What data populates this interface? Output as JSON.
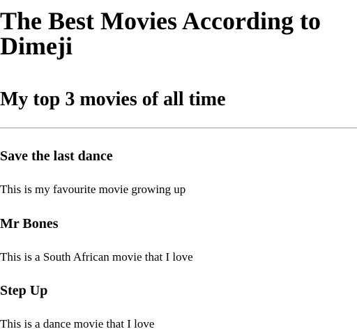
{
  "page": {
    "title": "The Best Movies According to Dimeji",
    "subtitle": "My top 3 movies of all time"
  },
  "movies": [
    {
      "title": "Save the last dance",
      "description": "This is my favourite movie growing up"
    },
    {
      "title": "Mr Bones",
      "description": "This is a South African movie that I love"
    },
    {
      "title": "Step Up",
      "description": "This is a dance movie that I love"
    }
  ]
}
